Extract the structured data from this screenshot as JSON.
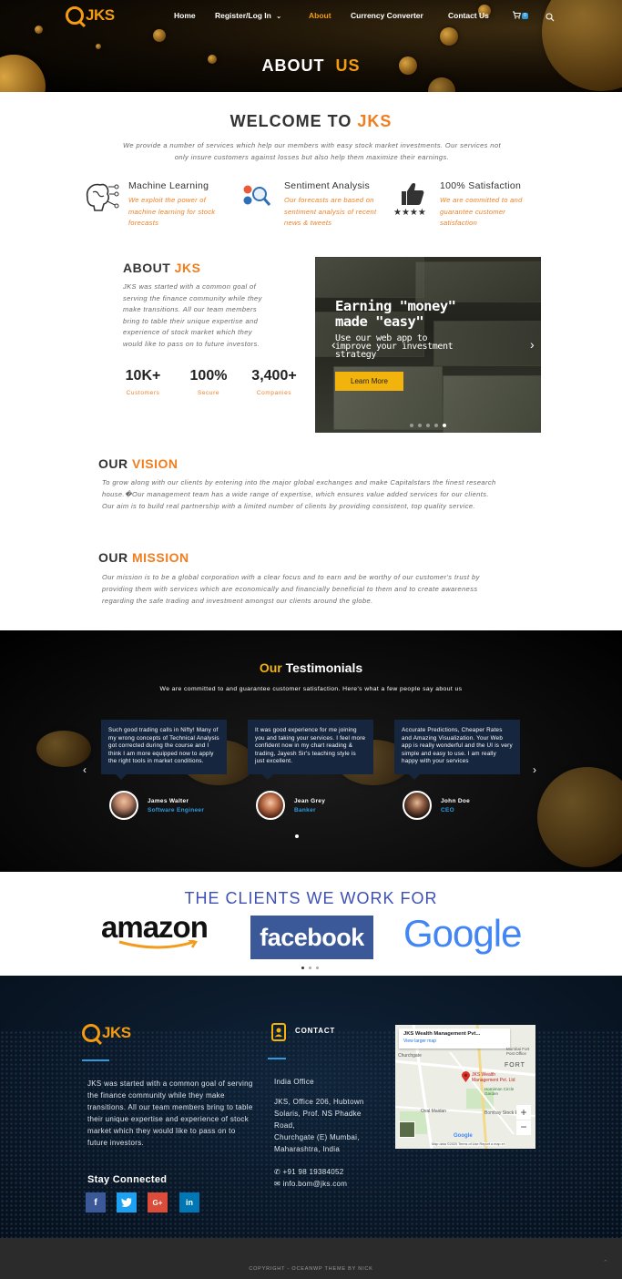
{
  "header": {
    "logo_text": "JKS",
    "nav": [
      {
        "label": "Home"
      },
      {
        "label": "Register/Log In"
      },
      {
        "label": "About"
      },
      {
        "label": "Currency Converter"
      },
      {
        "label": "Contact Us"
      }
    ],
    "cart_count": "0",
    "title_word1": "ABOUT",
    "title_word2": "US"
  },
  "welcome": {
    "title_prefix": "WELCOME TO ",
    "title_accent": "JKS",
    "text": "We provide a number of services which help our members with easy stock market investments.  Our services not only insure customers against losses but also help them maximize their earnings."
  },
  "features": [
    {
      "title": "Machine Learning",
      "desc": "We exploit the power of machine learning for stock forecasts",
      "icon": "brain-icon"
    },
    {
      "title": "Sentiment Analysis",
      "desc": "Our forecasts are based on sentiment analysis of recent news & tweets",
      "icon": "analysis-icon"
    },
    {
      "title": "100% Satisfaction",
      "desc": "We are committed to and guarantee customer satisfaction",
      "icon": "thumbs-up-icon"
    }
  ],
  "about": {
    "title_prefix": "ABOUT ",
    "title_accent": "JKS",
    "text": "JKS was started with a common goal of serving the finance community while they make transitions. All our team members bring to table their unique expertise and experience of stock market which they would like to pass on to future investors.",
    "stats": [
      {
        "value": "10K+",
        "label": "Customers"
      },
      {
        "value": "100%",
        "label": "Secure"
      },
      {
        "value": "3,400+",
        "label": "Companies"
      }
    ]
  },
  "slider": {
    "headline_line1": "Earning \"money\"",
    "headline_line2": "made \"easy\"",
    "sub_line1": "Use our web app to",
    "sub_line2": "improve your investment",
    "sub_line3": "strategy",
    "button": "Learn More",
    "dots_count": 5,
    "active_dot": 4
  },
  "vision": {
    "title_prefix": "OUR ",
    "title_accent": "VISION",
    "text": "To grow along with our clients by entering into the major global exchanges and make Capitalstars the finest research house.�Our management team has a wide range of expertise, which ensures value added services for our clients. Our aim is to build real partnership with a limited number of clients by providing consistent, top quality service."
  },
  "mission": {
    "title_prefix": "OUR ",
    "title_accent": "MISSION",
    "text": "Our mission is to be a global corporation with a clear focus and to earn and be worthy of our customer's trust by providing them with services which are economically and financially beneficial to them and to create awareness regarding the safe trading and investment amongst our clients around the globe."
  },
  "testimonials": {
    "title_accent": "Our",
    "title_rest": " Testimonials",
    "subtitle": "We are committed to and guarantee customer satisfaction. Here's what a few people say about us",
    "items": [
      {
        "text": "Such good trading calls in Nifty! Many of my wrong concepts of Technical Analysis got corrected during the course and I think I am more equipped now to apply the right tools in market conditions.",
        "name": "James Walter",
        "role": "Software Engineer"
      },
      {
        "text": "It was good experience for me joining you and taking your services. I feel more confident now in my chart reading & trading, Jayesh Sir's teaching style is just excellent.",
        "name": "Jean Grey",
        "role": "Banker"
      },
      {
        "text": "Accurate Predictions, Cheaper Rates and Amazing Visualization. Your Web app is really wonderful and the UI is very simple and easy to use. I am really happy with your services",
        "name": "John Doe",
        "role": "CEO"
      }
    ]
  },
  "clients": {
    "title": "THE CLIENTS WE WORK FOR",
    "logos": [
      "amazon",
      "facebook",
      "Google"
    ]
  },
  "footer": {
    "logo_text": "JKS",
    "about_text": "JKS was started with a common goal of serving the finance community while they make transitions. All our team members bring to table their unique expertise and experience of stock market which they would like to pass on to future investors.",
    "stay_connected": "Stay Connected",
    "contact_title": "CONTACT",
    "office_label": "India Office",
    "address_lines": [
      "JKS, Office 206, Hubtown",
      "Solaris, Prof. NS Phadke",
      "Road,",
      "Churchgate (E) Mumbai,",
      "Maharashtra, India"
    ],
    "phone": "+91 98 19384052",
    "email": "info.bom@jks.com",
    "map": {
      "place": "JKS Wealth Management Pvt...",
      "larger_map": "View larger map",
      "pin_label_1": "JKS Wealth",
      "pin_label_2": "Management Pvt. Ltd",
      "labels": [
        "Churchgate",
        "FORT",
        "Oval Maidan",
        "Horniman Circle Garden",
        "Bombay Stock E",
        "Mumbai Fort Post Office"
      ],
      "attribution": "Map data ©2020   Terms of Use   Report a map er"
    }
  },
  "copyright": "COPYRIGHT - OCEANWP THEME BY NICK",
  "colors": {
    "accent": "#f07d1e",
    "nav_active": "#f39c12",
    "clients_title": "#3f51b5",
    "footer_bg": "#0a1726"
  }
}
